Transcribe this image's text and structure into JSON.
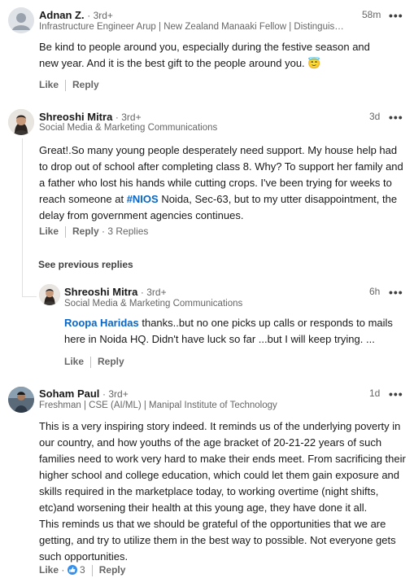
{
  "comments": [
    {
      "name": "Adnan Z.",
      "degree": "· 3rd+",
      "headline": "Infrastructure Engineer Arup | New Zealand Manaaki Fellow | Distinguished ...",
      "time": "58m",
      "body": "Be kind to people around you, especially during the festive season and new year. And it is the best gift to the people around you. 😇",
      "like_label": "Like",
      "reply_label": "Reply"
    },
    {
      "name": "Shreoshi Mitra",
      "degree": "· 3rd+",
      "headline": "Social Media & Marketing Communications",
      "time": "3d",
      "body_pre": "Great!.So many young people desperately need support. My house help had to drop out of school after completing class 8. Why? To support her family and a father who lost his hands while cutting crops. I've been trying for weeks to reach someone at ",
      "hashtag": "#NIOS",
      "body_post": " Noida, Sec-63, but to my utter disappointment, the delay from government agencies continues.",
      "like_label": "Like",
      "reply_label": "Reply",
      "replies_count": "· 3 Replies"
    },
    {
      "name": "Shreoshi Mitra",
      "degree": "· 3rd+",
      "headline": "Social Media & Marketing Communications",
      "time": "6h",
      "mention": "Roopa Haridas",
      "body_post": " thanks..but no one picks up calls or responds to mails here in Noida HQ. Didn't have luck so far ...but I will keep trying. ...",
      "like_label": "Like",
      "reply_label": "Reply"
    },
    {
      "name": "Soham Paul",
      "degree": "· 3rd+",
      "headline": "Freshman | CSE (AI/ML) | Manipal Institute of Technology",
      "time": "1d",
      "body": "This is a very inspiring story indeed. It reminds us of the underlying poverty in our country, and how youths of the age bracket of 20-21-22 years of such families need to work very hard to make their ends meet. From sacrificing their higher school and college education, which could let them gain exposure and skills required in the marketplace today, to working overtime (night shifts, etc)and worsening their health at this young age, they have done it all.\nThis reminds us that we should be grateful of the opportunities that we are getting, and try to utilize them in the best way to possible. Not everyone gets such opportunities.",
      "like_label": "Like",
      "like_sep": "·",
      "reaction_count": "3",
      "reply_label": "Reply"
    }
  ],
  "see_previous": "See previous replies",
  "more_glyph": "•••",
  "colors": {
    "link": "#0a66c2",
    "muted": "#666666",
    "like_badge": "#378fe9"
  },
  "icons": [
    "overflow-menu-icon",
    "like-reaction-icon"
  ]
}
